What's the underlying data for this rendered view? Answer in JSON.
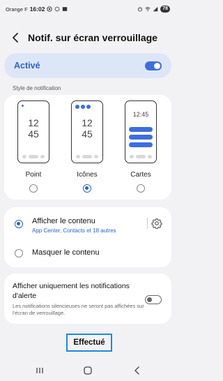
{
  "status_bar": {
    "carrier": "Orange F",
    "time": "16:02",
    "battery": "78"
  },
  "header": {
    "title": "Notif. sur écran verrouillage"
  },
  "active_toggle": {
    "label": "Activé",
    "state": "on"
  },
  "style_section": {
    "label": "Style de notification",
    "options": [
      {
        "label": "Point",
        "selected": false
      },
      {
        "label": "Icônes",
        "selected": true
      },
      {
        "label": "Cartes",
        "selected": false
      }
    ],
    "preview_clock": {
      "hours": "12",
      "minutes": "45"
    },
    "cards_clock": "12:45"
  },
  "content_section": {
    "show": {
      "title": "Afficher le contenu",
      "subtitle": "App Center, Contacts et 18 autres",
      "selected": true
    },
    "hide": {
      "title": "Masquer le contenu",
      "selected": false
    }
  },
  "alert_section": {
    "title": "Afficher uniquement les notifications d'alerte",
    "description": "Les notifications silencieuses ne seront pas affichées sur l'écran de verrouillage.",
    "state": "off"
  },
  "done_button": {
    "label": "Effectué"
  },
  "colors": {
    "accent": "#2763d8",
    "active_card_bg": "#dde6f7",
    "background": "#f2f2f4",
    "focus_outline": "#1e88e5"
  },
  "icons": [
    "back-arrow-icon",
    "gear-icon",
    "recent-apps-icon",
    "home-icon",
    "back-nav-icon"
  ]
}
